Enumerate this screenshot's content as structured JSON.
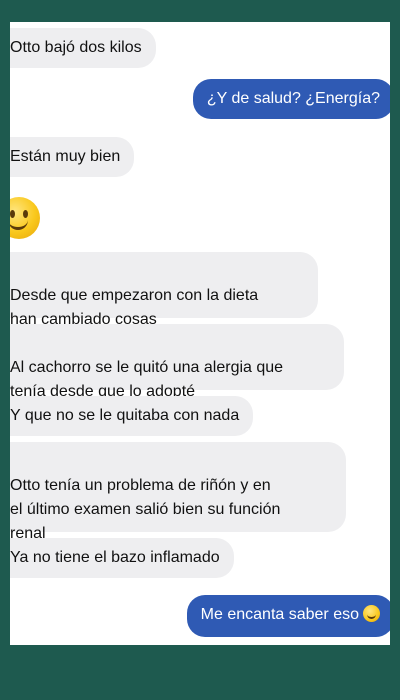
{
  "messages": [
    {
      "text": "Otto bajó dos kilos"
    },
    {
      "text": "¿Y de salud? ¿Energía?"
    },
    {
      "text": "Están muy bien"
    },
    {
      "text": "Desde que empezaron con la dieta\nhan cambiado cosas"
    },
    {
      "text": "Al cachorro se le quitó una alergia que\ntenía desde que lo adopté"
    },
    {
      "text": "Y que no se le quitaba con nada"
    },
    {
      "text": "Otto tenía un problema de riñón y en\nel último examen salió bien su función\nrenal"
    },
    {
      "text": "Ya no tiene el bazo inflamado"
    },
    {
      "text": "Me encanta saber eso"
    }
  ],
  "colors": {
    "background": "#1e5a4f",
    "incoming_bubble": "#eeeef0",
    "outgoing_bubble": "#2f5ab4"
  },
  "icons": [
    "smiling-face-emoji-icon",
    "smiling-face-emoji-icon"
  ]
}
